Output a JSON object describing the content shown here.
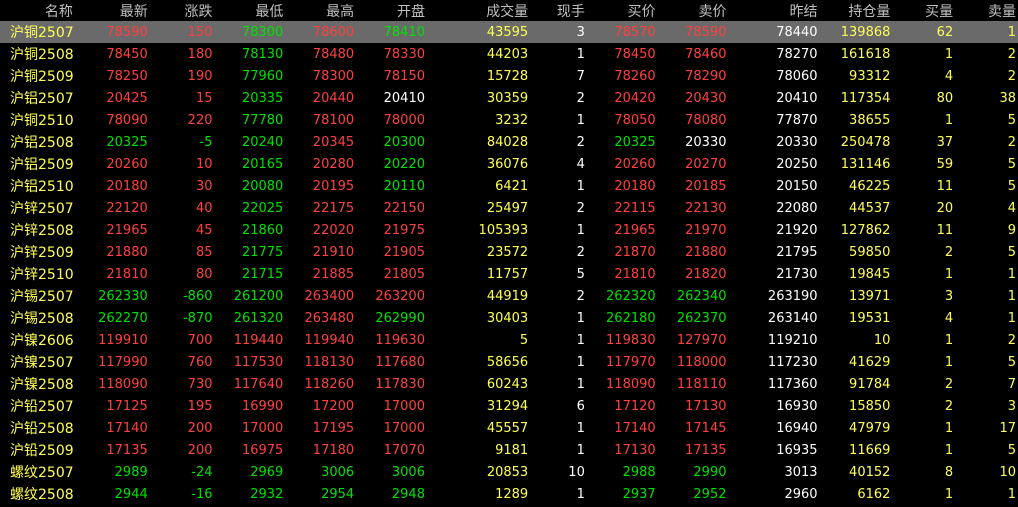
{
  "headers": [
    "名称",
    "最新",
    "涨跌",
    "最低",
    "最高",
    "开盘",
    "成交量",
    "现手",
    "买价",
    "卖价",
    "昨结",
    "持仓量",
    "买量",
    "卖量"
  ],
  "colors": {
    "up": "#ff4040",
    "down": "#00e000",
    "flat": "#ffffff",
    "yellow": "#ffff55",
    "selected_bg": "#6a6a6a"
  },
  "rows": [
    [
      "沪铜2507",
      "78590",
      "150",
      "78300",
      "78600",
      "78410",
      "43595",
      "3",
      "78570",
      "78590",
      "78440",
      "139868",
      "62",
      "1"
    ],
    [
      "沪铜2508",
      "78450",
      "180",
      "78130",
      "78480",
      "78330",
      "44203",
      "1",
      "78450",
      "78460",
      "78270",
      "161618",
      "1",
      "2"
    ],
    [
      "沪铜2509",
      "78250",
      "190",
      "77960",
      "78300",
      "78150",
      "15728",
      "7",
      "78260",
      "78290",
      "78060",
      "93312",
      "4",
      "2"
    ],
    [
      "沪铝2507",
      "20425",
      "15",
      "20335",
      "20440",
      "20410",
      "30359",
      "2",
      "20420",
      "20430",
      "20410",
      "117354",
      "80",
      "38"
    ],
    [
      "沪铜2510",
      "78090",
      "220",
      "77780",
      "78100",
      "78000",
      "3232",
      "1",
      "78050",
      "78080",
      "77870",
      "38655",
      "1",
      "5"
    ],
    [
      "沪铝2508",
      "20325",
      "-5",
      "20240",
      "20345",
      "20300",
      "84028",
      "2",
      "20325",
      "20330",
      "20330",
      "250478",
      "37",
      "2"
    ],
    [
      "沪铝2509",
      "20260",
      "10",
      "20165",
      "20280",
      "20220",
      "36076",
      "4",
      "20260",
      "20270",
      "20250",
      "131146",
      "59",
      "5"
    ],
    [
      "沪铝2510",
      "20180",
      "30",
      "20080",
      "20195",
      "20110",
      "6421",
      "1",
      "20180",
      "20185",
      "20150",
      "46225",
      "11",
      "5"
    ],
    [
      "沪锌2507",
      "22120",
      "40",
      "22025",
      "22175",
      "22150",
      "25497",
      "2",
      "22115",
      "22130",
      "22080",
      "44537",
      "20",
      "4"
    ],
    [
      "沪锌2508",
      "21965",
      "45",
      "21860",
      "22020",
      "21975",
      "105393",
      "1",
      "21965",
      "21970",
      "21920",
      "127862",
      "11",
      "9"
    ],
    [
      "沪锌2509",
      "21880",
      "85",
      "21775",
      "21910",
      "21905",
      "23572",
      "2",
      "21870",
      "21880",
      "21795",
      "59850",
      "2",
      "5"
    ],
    [
      "沪锌2510",
      "21810",
      "80",
      "21715",
      "21885",
      "21805",
      "11757",
      "5",
      "21810",
      "21820",
      "21730",
      "19845",
      "1",
      "1"
    ],
    [
      "沪锡2507",
      "262330",
      "-860",
      "261200",
      "263400",
      "263200",
      "44919",
      "2",
      "262320",
      "262340",
      "263190",
      "13971",
      "3",
      "1"
    ],
    [
      "沪锡2508",
      "262270",
      "-870",
      "261320",
      "263480",
      "262990",
      "30403",
      "1",
      "262180",
      "262370",
      "263140",
      "19531",
      "4",
      "1"
    ],
    [
      "沪镍2606",
      "119910",
      "700",
      "119440",
      "119940",
      "119630",
      "5",
      "1",
      "119830",
      "127970",
      "119210",
      "10",
      "1",
      "2"
    ],
    [
      "沪镍2507",
      "117990",
      "760",
      "117530",
      "118130",
      "117680",
      "58656",
      "1",
      "117970",
      "118000",
      "117230",
      "41629",
      "1",
      "5"
    ],
    [
      "沪镍2508",
      "118090",
      "730",
      "117640",
      "118260",
      "117830",
      "60243",
      "1",
      "118090",
      "118110",
      "117360",
      "91784",
      "2",
      "7"
    ],
    [
      "沪铅2507",
      "17125",
      "195",
      "16990",
      "17200",
      "17000",
      "31294",
      "6",
      "17120",
      "17130",
      "16930",
      "15850",
      "2",
      "3"
    ],
    [
      "沪铅2508",
      "17140",
      "200",
      "17000",
      "17195",
      "17000",
      "45557",
      "1",
      "17140",
      "17145",
      "16940",
      "47979",
      "1",
      "17"
    ],
    [
      "沪铅2509",
      "17135",
      "200",
      "16975",
      "17180",
      "17070",
      "9181",
      "1",
      "17130",
      "17135",
      "16935",
      "11669",
      "1",
      "5"
    ],
    [
      "螺纹2507",
      "2989",
      "-24",
      "2969",
      "3006",
      "3006",
      "20853",
      "10",
      "2988",
      "2990",
      "3013",
      "40152",
      "8",
      "10"
    ],
    [
      "螺纹2508",
      "2944",
      "-16",
      "2932",
      "2954",
      "2948",
      "1289",
      "1",
      "2937",
      "2952",
      "2960",
      "6162",
      "1",
      "1"
    ]
  ]
}
